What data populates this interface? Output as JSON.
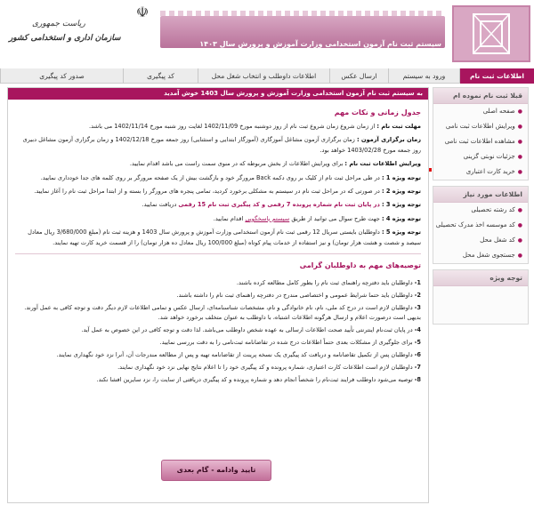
{
  "header": {
    "title": "سیستم ثبت نام آزمون استخدامی وزارت آموزش و پرورش سال ۱۴۰۳",
    "org_line1": "ریاست جمهوری",
    "org_line2": "سازمان اداری و استخدامی کشور",
    "emblem_icon": "iran-emblem-icon",
    "brand_color": "#a8155e"
  },
  "nav": {
    "tabs": [
      {
        "label": "اطلاعات ثبت نام",
        "active": true
      },
      {
        "label": "ورود به سیستم"
      },
      {
        "label": "ارسال عکس"
      },
      {
        "label": "اطلاعات داوطلب و انتخاب شغل محل"
      },
      {
        "label": "کد پیگیری"
      },
      {
        "label": "صدور کد پیگیری"
      }
    ]
  },
  "sidebar": {
    "box1_title": "قبلا ثبت نام نموده ام",
    "box1_items": [
      "صفحه اصلی",
      "ویرایش اطلاعات ثبت نامی",
      "مشاهده اطلاعات ثبت نامی",
      "جزئیات نوبتی گزینی",
      "خرید کارت اعتباری"
    ],
    "box2_title": "اطلاعات مورد نیاز",
    "box2_items": [
      "کد رشته تحصیلی",
      "کد موسسه اخذ مدرک تحصیلی",
      "کد شغل محل",
      "جستجوی شغل محل"
    ],
    "box3_title": "توجه ویژه"
  },
  "main": {
    "header": "به سیستم ثبت نام آزمون استخدامی وزارت آموزش و پرورش سال 1403 خوش آمدید",
    "section1_title": "جدول زمانی و نکات مهم",
    "p1_label": "مهلت ثبت نام :",
    "p1_text": "از زمان شروع زمان شروع ثبت نام از روز دوشنبه مورخ 1402/11/09 لغایت روز شنبه مورخ 1402/11/14 می باشد.",
    "p2_label": "زمان برگزاری آزمون :",
    "p2_text": "زمان برگزاری آزمون مشاغل آموزگاری (آموزگار ابتدایی و استثنایی) روز جمعه مورخ 1402/12/18 و زمان برگزاری آزمون مشاغل دبیری روز جمعه مورخ 1403/02/28 خواهد بود.",
    "p3_label": "ویرایش اطلاعات ثبت نام :",
    "p3_text": "برای ویرایش اطلاعات از بخش مربوطه که در منوی سمت راست می باشد اقدام نمایید.",
    "note1_label": "توجه ویژه 1 :",
    "note1_text": "در طی مراحل ثبت نام از کلیک بر روی دکمه Back مرورگر خود و بازگشت بیش از یک صفحه مرورگر بر روی کلمه های جدا خودداری نمایید.",
    "note2_label": "توجه ویژه 2 :",
    "note2_text": "در صورتی که در مراحل ثبت نام در سیستم به مشکلی برخورد کردید، تمامی پنجره های مرورگر را بسته و از ابتدا مراحل ثبت نام را آغاز نمایید.",
    "note3_label": "توجه ویژه 3 :",
    "note3_text_a": "در پایان ثبت نام شماره پرونده 7 رقمی و کد پیگیری ثبت نام 15 رقمی",
    "note3_text_b": "دریافت نمایید.",
    "note4_label": "توجه ویژه 4 :",
    "note4_text_a": "جهت طرح سوال می توانید از طریق",
    "note4_link": "سیستم پاسخگویی",
    "note4_text_b": "اقدام نمایید.",
    "note5_label": "توجه ویژه 5 :",
    "note5_text": "داوطلبان بایستی سریال 12 رقمی ثبت نام آزمون استخدامی وزارت آموزش و پرورش سال 1403 و هزینه ثبت نام (مبلغ 3/680/000 ریال معادل سیصد و شصت و هشت هزار تومان) و نیز استفاده از خدمات پیام کوتاه (مبلغ 100/000 ریال معادل ده هزار تومان) را از قسمت خرید کارت تهیه نمایند.",
    "section2_title": "توصیه‌های مهم به داوطلبان گرامی",
    "recommendations": [
      "داوطلبان باید دفترچه راهنمای ثبت نام را بطور کامل مطالعه کرده باشند.",
      "داوطلبان باید حتما شرایط عمومی و اختصاصی مندرج در دفترچه راهنمای ثبت نام را داشته باشند.",
      "داوطلبان لازم است در درج کد ملی، نام، نام خانوادگی و نام، مشخصات شناسنامه‌ای، ارسال عکس و تمامی اطلاعات لازم دیگر دقت و توجه کافی به عمل آورند. بدیهی است درصورت اعلام و ارسال هرگونه اطلاعات اشتباه، با داوطلب به عنوان متخلف برخورد خواهد شد.",
      "در پایان ثبت‌نام اینترنتی تأیید صحت اطلاعات ارسالی به عهده شخص داوطلب می‌باشد. لذا دقت و توجه کافی در این خصوص به عمل آید.",
      "برای جلوگیری از مشکلات بعدی حتماً اطلاعات درج شده در تقاضانامه ثبت‌نامی را به دقت بررسی نمایید.",
      "داوطلبان پس از تکمیل تقاضانامه و دریافت کد پیگیری یک نسخه پرینت از تقاضانامه تهیه و پس از مطالعه مندرجات آن، آنرا نزد خود نگهداری نمایند.",
      "داوطلبان لازم است اطلاعات کارت اعتباری، شماره پرونده و کد پیگیری خود را تا اعلام نتایج نهایی نزد خود نگهداری نمایند.",
      "توصیه می‌شود داوطلب فرایند ثبت‌نام را شخصاً انجام دهد و شماره پرونده و کد پیگیری دریافتی از سایت را، نزد سایرین افشا نکند."
    ],
    "next_button": "تایید وادامه - گام بعدی"
  }
}
